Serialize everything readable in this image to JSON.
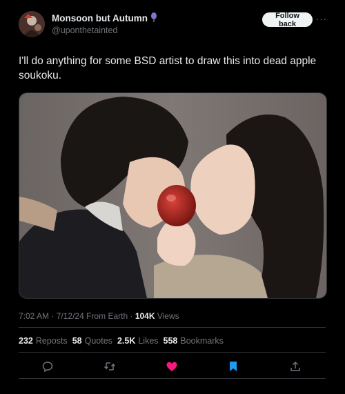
{
  "author": {
    "display_name": "Monsoon but Autumn",
    "handle": "@uponthetainted",
    "badge_icon": "purple-flower-icon"
  },
  "follow_button_label": "Follow back",
  "more_icon": "more-options-icon",
  "post": {
    "text": "I'll do anything for some BSD artist to draw this into dead apple soukoku."
  },
  "meta": {
    "time": "7:02 AM",
    "date": "7/12/24",
    "source": "From Earth",
    "views_count": "104K",
    "views_label": "Views"
  },
  "stats": {
    "reposts_count": "232",
    "reposts_label": "Reposts",
    "quotes_count": "58",
    "quotes_label": "Quotes",
    "likes_count": "2.5K",
    "likes_label": "Likes",
    "bookmarks_count": "558",
    "bookmarks_label": "Bookmarks"
  },
  "actions": [
    {
      "name": "reply-icon",
      "color": "#71767b"
    },
    {
      "name": "repost-icon",
      "color": "#71767b"
    },
    {
      "name": "like-icon",
      "color": "#f91880"
    },
    {
      "name": "bookmark-icon",
      "color": "#1d9bf0"
    },
    {
      "name": "share-icon",
      "color": "#71767b"
    }
  ]
}
